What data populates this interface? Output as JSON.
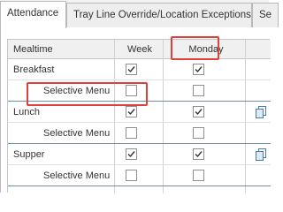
{
  "tabs": [
    {
      "label": "Attendance",
      "active": true
    },
    {
      "label": "Tray Line Override/Location Exceptions",
      "active": false
    },
    {
      "label": "Se",
      "active": false
    }
  ],
  "grid": {
    "columns": {
      "mealtime": "Mealtime",
      "week": "Week",
      "monday": "Monday"
    },
    "rows": [
      {
        "label": "Breakfast",
        "week": true,
        "monday": true,
        "copy_icon": false
      },
      {
        "label": "Selective Menu",
        "week": false,
        "monday": false,
        "copy_icon": false
      },
      {
        "label": "Lunch",
        "week": true,
        "monday": true,
        "copy_icon": true
      },
      {
        "label": "Selective Menu",
        "week": false,
        "monday": false,
        "copy_icon": false
      },
      {
        "label": "Supper",
        "week": true,
        "monday": true,
        "copy_icon": true
      },
      {
        "label": "Selective Menu",
        "week": false,
        "monday": false,
        "copy_icon": false
      }
    ]
  },
  "colors": {
    "highlight": "#e0403c",
    "group_divider": "#6d8ea6",
    "copy_icon": "#4a7aa8"
  },
  "icons": {
    "checkmark": "check-icon",
    "copy": "copy-icon"
  }
}
